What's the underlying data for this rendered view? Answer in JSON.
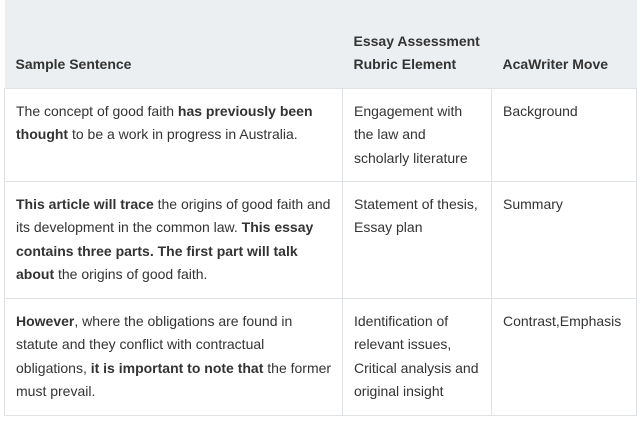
{
  "table": {
    "headers": [
      "Sample Sentence",
      "Essay Assessment Rubric Element",
      "AcaWriter Move"
    ],
    "rows": [
      {
        "sentence": [
          {
            "text": "The concept of good faith ",
            "bold": false
          },
          {
            "text": "has previously been thought",
            "bold": true
          },
          {
            "text": " to be a work in progress in Australia.",
            "bold": false
          }
        ],
        "rubric": "Engagement with the law and scholarly literature",
        "move": "Background"
      },
      {
        "sentence": [
          {
            "text": "This article will trace",
            "bold": true
          },
          {
            "text": " the origins of good faith and its development in the common law. ",
            "bold": false
          },
          {
            "text": "This essay contains three parts. The first part will talk about",
            "bold": true
          },
          {
            "text": " the origins of good faith.",
            "bold": false
          }
        ],
        "rubric": "Statement of thesis, Essay plan",
        "move": "Summary"
      },
      {
        "sentence": [
          {
            "text": "However",
            "bold": true
          },
          {
            "text": ", where the obligations are found in statute and they conflict with contractual obligations, ",
            "bold": false
          },
          {
            "text": "it is important to note that",
            "bold": true
          },
          {
            "text": " the former must prevail.",
            "bold": false
          }
        ],
        "rubric": "Identification of relevant issues, Critical analysis and original insight",
        "move": "Contrast,Emphasis"
      }
    ]
  }
}
